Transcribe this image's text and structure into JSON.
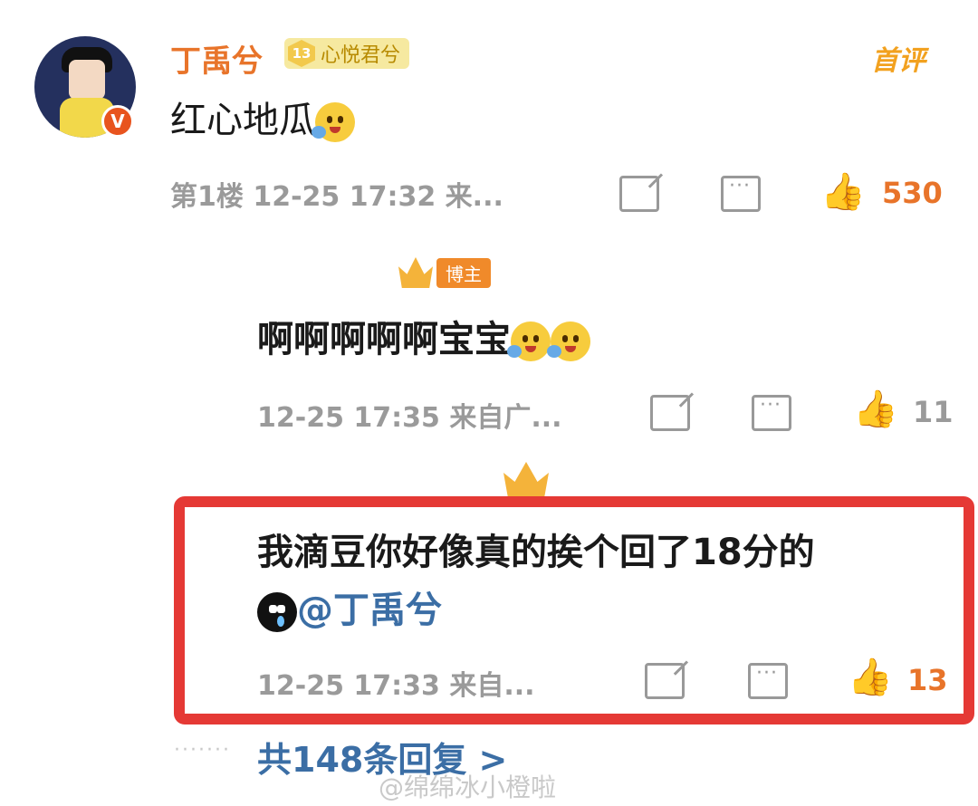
{
  "comment1": {
    "username": "丁禹兮",
    "fan_badge": {
      "level": "13",
      "name": "心悦君兮"
    },
    "tag": "首评",
    "verified_mark": "V",
    "text": "红心地瓜",
    "floor": "第1楼",
    "time": "12-25 17:32",
    "source": "来...",
    "likes": "530"
  },
  "reply1": {
    "badge_label": "博主",
    "text": "啊啊啊啊啊宝宝",
    "time": "12-25 17:35",
    "source": "来自广...",
    "likes": "11"
  },
  "reply2": {
    "text": "我滴豆你好像真的挨个回了18分的",
    "mention": "@丁禹兮",
    "time": "12-25 17:33",
    "source": "来自...",
    "likes": "13"
  },
  "footer": {
    "dots": "·······",
    "replies_link": "共148条回复 >",
    "watermark": "@绵绵冰小橙啦"
  },
  "colors": {
    "username": "#e8742a",
    "link": "#3b6ea5",
    "highlight_border": "#e53935",
    "meta_gray": "#9a9a9a"
  },
  "icons": [
    "share-icon",
    "comment-icon",
    "like-icon",
    "crown-icon",
    "emoji-icon"
  ]
}
